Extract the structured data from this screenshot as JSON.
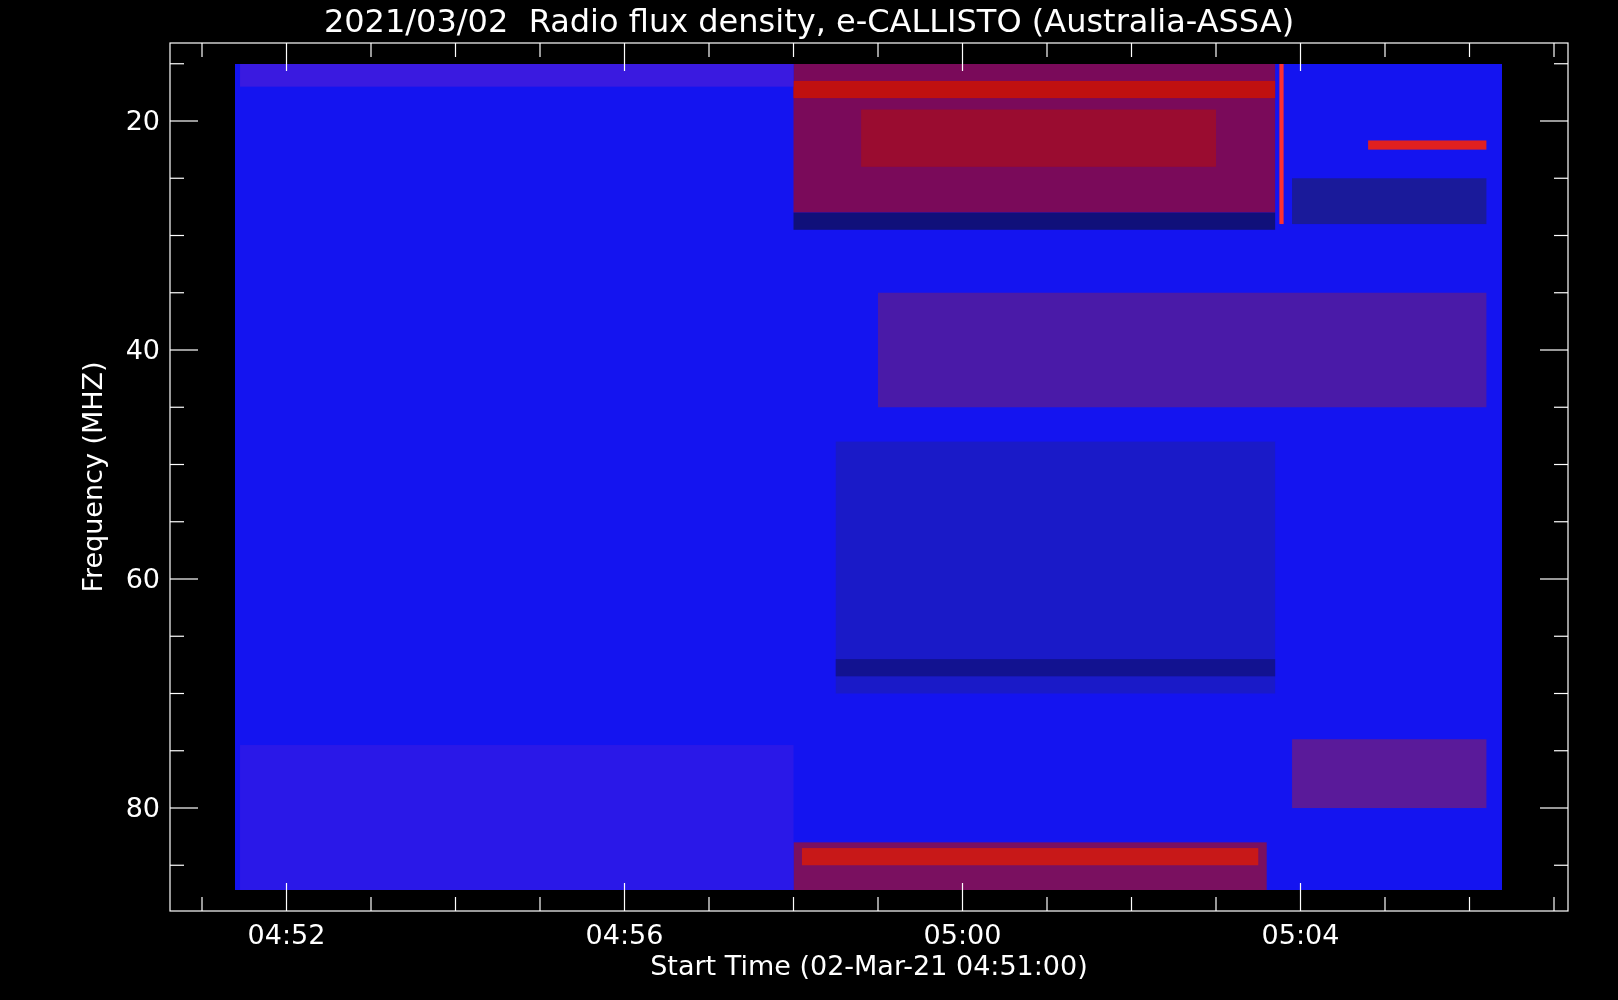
{
  "title": "2021/03/02  Radio flux density, e-CALLISTO (Australia-ASSA)",
  "y_axis": {
    "label": "Frequency (MHZ)",
    "ticks": [
      "20",
      "40",
      "60",
      "80"
    ]
  },
  "x_axis": {
    "label": "Start Time (02-Mar-21 04:51:00)",
    "ticks": [
      "04:52",
      "04:56",
      "05:00",
      "05:04"
    ]
  }
}
